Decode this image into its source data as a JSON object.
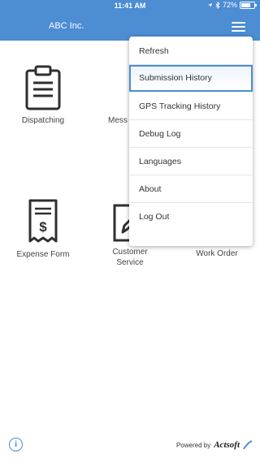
{
  "statusbar": {
    "time": "11:41 AM",
    "battery": "72%",
    "battery_level": 0.72
  },
  "header": {
    "title": "ABC Inc."
  },
  "tiles": [
    {
      "label": "Dispatching",
      "icon": "clipboard-icon"
    },
    {
      "label": "Mess",
      "icon": "message-icon"
    },
    {
      "label": "Expense Form",
      "icon": "receipt-icon"
    },
    {
      "label": "Customer\nService",
      "icon": "edit-icon"
    },
    {
      "label": "Work Order",
      "icon": "work-order-icon"
    }
  ],
  "menu": {
    "items": [
      {
        "label": "Refresh"
      },
      {
        "label": "Submission History",
        "selected": true
      },
      {
        "label": "GPS Tracking History"
      },
      {
        "label": "Debug Log"
      },
      {
        "label": "Languages"
      },
      {
        "label": "About"
      },
      {
        "label": "Log Out"
      }
    ]
  },
  "footer": {
    "powered_by": "Powered by",
    "brand": "Actsoft"
  },
  "colors": {
    "primary": "#4c8dd3",
    "icon": "#2f2f2f"
  }
}
